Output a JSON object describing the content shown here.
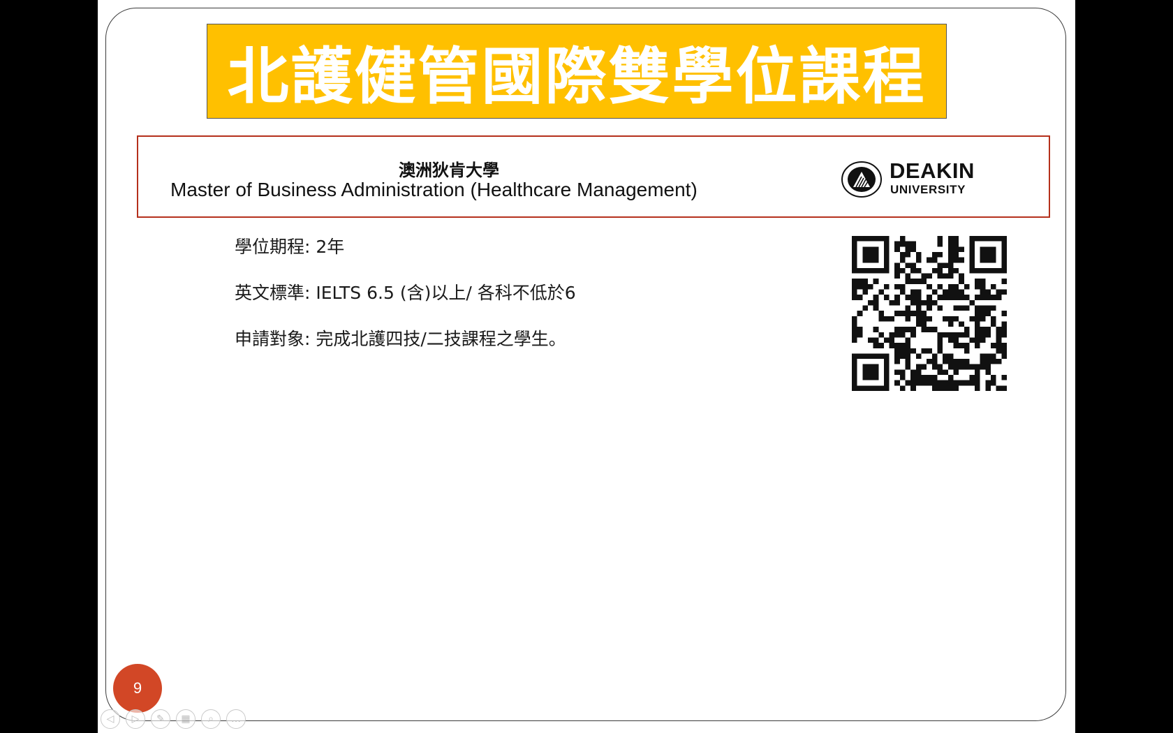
{
  "slide": {
    "title": "北護健管國際雙學位課程",
    "university": {
      "name_zh": "澳洲狄肯大學",
      "program": "Master of Business Administration (Healthcare Management)",
      "logo_word": "DEAKIN",
      "logo_sub": "UNIVERSITY"
    },
    "details": {
      "duration": "學位期程: 2年",
      "english": "英文標準: IELTS 6.5 (含)以上/ 各科不低於6",
      "applicant": "申請對象: 完成北護四技/二技課程之學生。"
    },
    "page_number": "9"
  },
  "controls": [
    {
      "name": "previous-slide-icon",
      "glyph": "◁"
    },
    {
      "name": "next-slide-icon",
      "glyph": "▷"
    },
    {
      "name": "pen-icon",
      "glyph": "✎"
    },
    {
      "name": "slides-grid-icon",
      "glyph": "▦"
    },
    {
      "name": "zoom-icon",
      "glyph": "⌕"
    },
    {
      "name": "more-options-icon",
      "glyph": "…"
    }
  ],
  "colors": {
    "title_banner": "#ffc000",
    "university_border": "#b5301c",
    "page_badge": "#d24726"
  }
}
